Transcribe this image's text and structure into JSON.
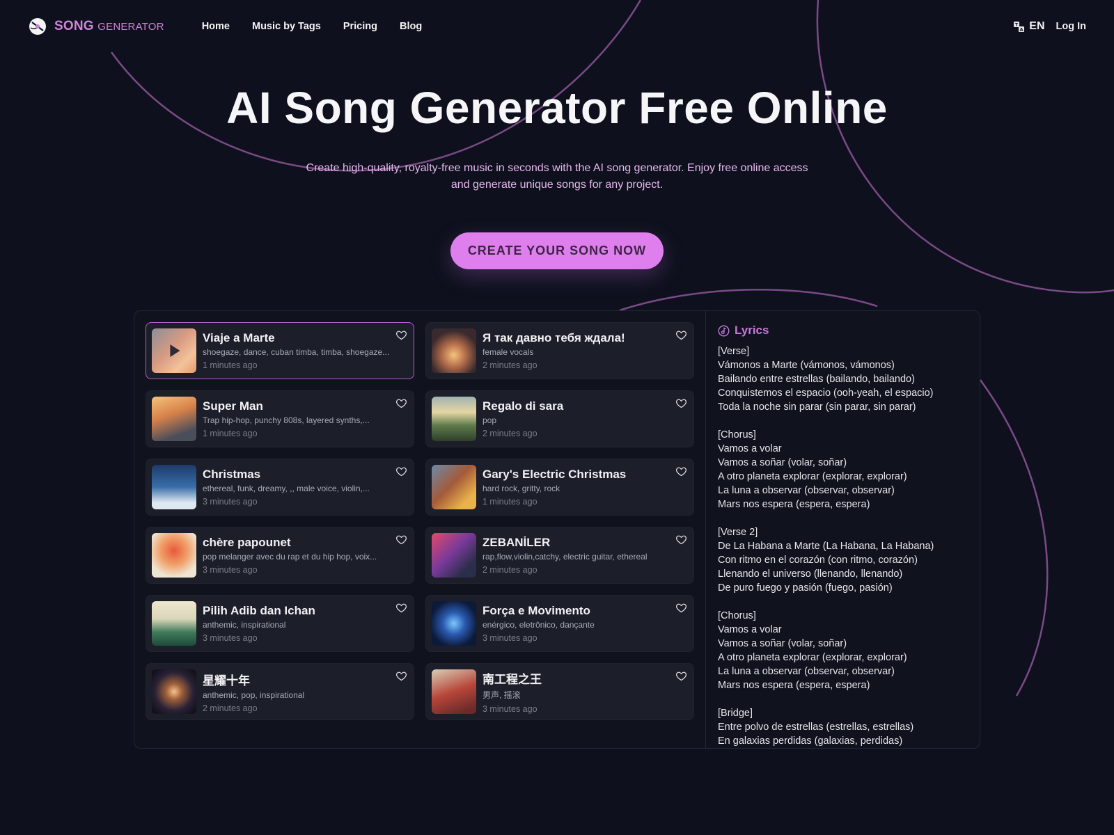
{
  "brand": {
    "name_bold": "SONG",
    "name_rest": "GENERATOR"
  },
  "nav": [
    "Home",
    "Music by Tags",
    "Pricing",
    "Blog"
  ],
  "header": {
    "language": "EN",
    "login": "Log In"
  },
  "hero": {
    "title": "AI Song Generator Free Online",
    "subtitle": "Create high-quality, royalty-free music in seconds with the AI song generator. Enjoy free online access and generate unique songs for any project.",
    "cta": "CREATE YOUR SONG NOW"
  },
  "colors": {
    "accent": "#df7fee",
    "background": "#0e111d",
    "card": "#1c1e2a",
    "active_border": "#b25fd0",
    "lyrics_title": "#c779db"
  },
  "songs": [
    {
      "title": "Viaje a Marte",
      "tags": "shoegaze, dance, cuban timba, timba, shoegaze...",
      "time": "1 minutes ago",
      "active": true,
      "thumb": "rocket"
    },
    {
      "title": "Я так давно тебя ждала!",
      "tags": "female vocals",
      "time": "2 minutes ago",
      "thumb": "couple-heart"
    },
    {
      "title": "Super Man",
      "tags": "Trap hip-hop, punchy 808s, layered synths,...",
      "time": "1 minutes ago",
      "thumb": "superhero"
    },
    {
      "title": "Regalo di sara",
      "tags": "pop",
      "time": "2 minutes ago",
      "thumb": "river-landscape"
    },
    {
      "title": "Christmas",
      "tags": "ethereal, funk, dreamy, ,, male voice, violin,...",
      "time": "3 minutes ago",
      "thumb": "santa-snow"
    },
    {
      "title": "Gary's Electric Christmas",
      "tags": "hard rock, gritty, rock",
      "time": "1 minutes ago",
      "thumb": "guitarist-tree"
    },
    {
      "title": "chère papounet",
      "tags": "pop melanger avec du rap et du hip hop, voix...",
      "time": "3 minutes ago",
      "thumb": "autumn-tree"
    },
    {
      "title": "ZEBANİLER",
      "tags": "rap,flow,violin,catchy, electric guitar, ethereal",
      "time": "2 minutes ago",
      "thumb": "studio-mixer"
    },
    {
      "title": "Pilih Adib dan Ichan",
      "tags": "anthemic, inspirational",
      "time": "3 minutes ago",
      "thumb": "pine-tree"
    },
    {
      "title": "Força e Movimento",
      "tags": "enérgico, eletrônico, dançante",
      "time": "3 minutes ago",
      "thumb": "server-hall"
    },
    {
      "title": "星耀十年",
      "tags": "anthemic, pop, inspirational",
      "time": "2 minutes ago",
      "thumb": "galaxy"
    },
    {
      "title": "南工程之王",
      "tags": "男声, 摇滚",
      "time": "3 minutes ago",
      "thumb": "king-guitar"
    }
  ],
  "lyrics": {
    "heading": "Lyrics",
    "text": "[Verse]\nVámonos a Marte (vámonos, vámonos)\nBailando entre estrellas (bailando, bailando)\nConquistemos el espacio (ooh-yeah, el espacio)\nToda la noche sin parar (sin parar, sin parar)\n\n[Chorus]\nVamos a volar\nVamos a soñar (volar, soñar)\nA otro planeta explorar (explorar, explorar)\nLa luna a observar (observar, observar)\nMars nos espera (espera, espera)\n\n[Verse 2]\nDe La Habana a Marte (La Habana, La Habana)\nCon ritmo en el corazón (con ritmo, corazón)\nLlenando el universo (llenando, llenando)\nDe puro fuego y pasión (fuego, pasión)\n\n[Chorus]\nVamos a volar\nVamos a soñar (volar, soñar)\nA otro planeta explorar (explorar, explorar)\nLa luna a observar (observar, observar)\nMars nos espera (espera, espera)\n\n[Bridge]\nEntre polvo de estrellas (estrellas, estrellas)\nEn galaxias perdidas (galaxias, perdidas)"
  }
}
